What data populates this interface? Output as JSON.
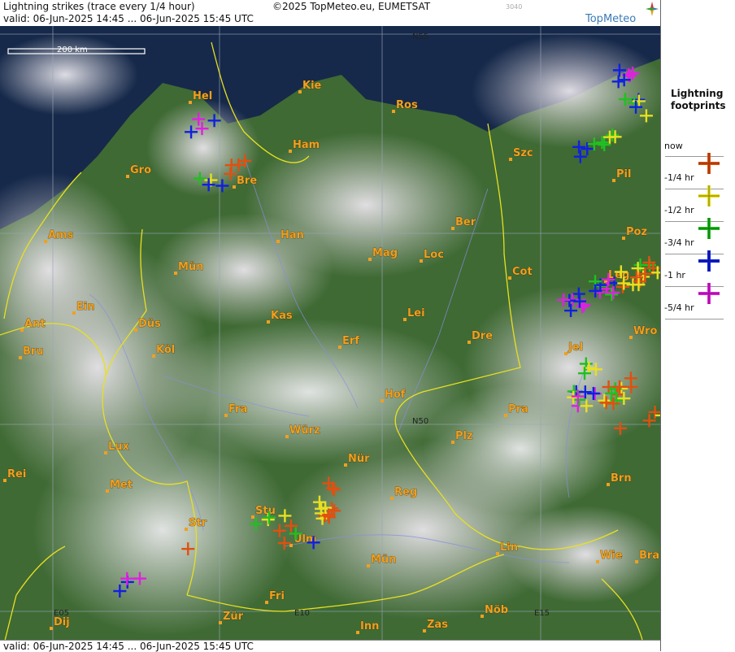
{
  "header": {
    "title": "Lightning strikes (trace every 1/4 hour)",
    "copyright": "©2025 TopMeteo.eu, EUMETSAT",
    "code": "3040",
    "valid": "valid:  06-Jun-2025 14:45 ... 06-Jun-2025 15:45 UTC",
    "brand": "TopMeteo"
  },
  "footer": {
    "valid": "valid:  06-Jun-2025 14:45 ... 06-Jun-2025 15:45 UTC"
  },
  "scale_bar": {
    "label": "200 km"
  },
  "legend": {
    "title": "Lightning footprints",
    "items": [
      {
        "label": "now",
        "color": "#e05010"
      },
      {
        "label": "-1/4 hr",
        "color": "#e8e020"
      },
      {
        "label": "-1/2 hr",
        "color": "#20c020"
      },
      {
        "label": "-3/4 hr",
        "color": "#1020e0"
      },
      {
        "label": "-1 hr",
        "color": "#e020e0"
      },
      {
        "label": "-5/4 hr",
        "color": ""
      }
    ]
  },
  "grid_labels": [
    "N55",
    "N50",
    "E05",
    "E10",
    "E15"
  ],
  "cities": [
    "Hel",
    "Kie",
    "Ros",
    "Ham",
    "Szc",
    "Gro",
    "Bre",
    "Pil",
    "Ams",
    "Han",
    "Ber",
    "Mag",
    "Loc",
    "Poz",
    "Mün",
    "Cot",
    "Leg",
    "Ein",
    "Kas",
    "Lei",
    "Ant",
    "Düs",
    "Wro",
    "Bru",
    "Köl",
    "Erf",
    "Dre",
    "Jel",
    "Hof",
    "Fra",
    "Pra",
    "Würz",
    "Plz",
    "Lux",
    "Nür",
    "Rei",
    "Met",
    "Reg",
    "Brn",
    "Stu",
    "Str",
    "Ulm",
    "Lin",
    "Mün",
    "Wie",
    "Bra",
    "Fri",
    "Dij",
    "Zür",
    "Inn",
    "Zas",
    "Nöb"
  ]
}
